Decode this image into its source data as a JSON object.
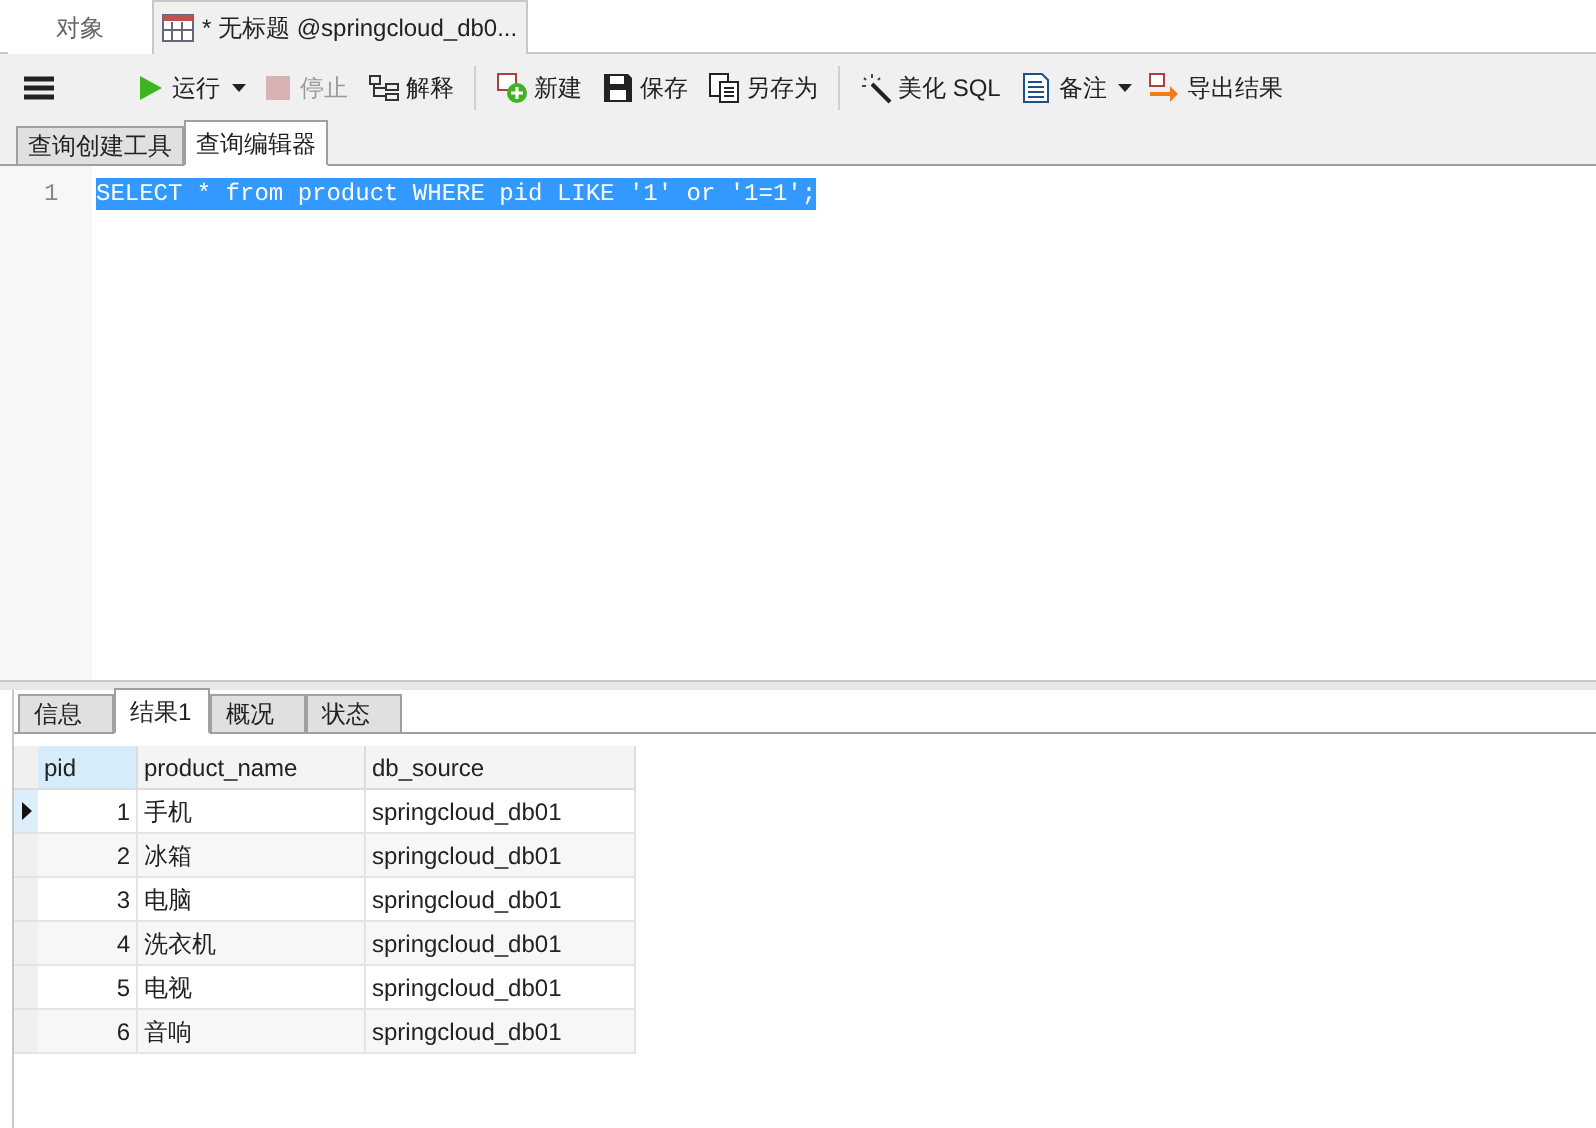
{
  "doc_tabs": [
    {
      "label": "对象",
      "selected": false
    },
    {
      "label": "* 无标题 @springcloud_db0...",
      "selected": true
    }
  ],
  "toolbar": {
    "groups": [
      [
        {
          "label": "运行",
          "disabled": false,
          "has_menu": true
        },
        {
          "label": "停止",
          "disabled": true,
          "has_menu": false
        },
        {
          "label": "解释",
          "disabled": false,
          "has_menu": false
        }
      ],
      [
        {
          "label": "新建",
          "disabled": false,
          "has_menu": false
        },
        {
          "label": "保存",
          "disabled": false,
          "has_menu": false
        },
        {
          "label": "另存为",
          "disabled": false,
          "has_menu": false
        }
      ],
      [
        {
          "label": "美化 SQL",
          "disabled": false,
          "has_menu": false
        },
        {
          "label": "备注",
          "disabled": false,
          "has_menu": true
        },
        {
          "label": "导出结果",
          "disabled": false,
          "has_menu": false
        }
      ]
    ]
  },
  "editor_tabs": [
    {
      "label": "查询创建工具",
      "selected": false
    },
    {
      "label": "查询编辑器",
      "selected": true
    }
  ],
  "editor": {
    "lines": [
      {
        "number": "1",
        "text": "SELECT * from product WHERE pid LIKE '1' or '1=1';",
        "selected": true
      }
    ]
  },
  "result_tabs": [
    {
      "label": "信息",
      "selected": false
    },
    {
      "label": "结果1",
      "selected": true
    },
    {
      "label": "概况",
      "selected": false
    },
    {
      "label": "状态",
      "selected": false
    }
  ],
  "table": {
    "columns": [
      "pid",
      "product_name",
      "db_source"
    ],
    "rows": [
      {
        "cells": [
          "1",
          "手机",
          "springcloud_db01"
        ],
        "selected": true
      },
      {
        "cells": [
          "2",
          "冰箱",
          "springcloud_db01"
        ],
        "selected": false
      },
      {
        "cells": [
          "3",
          "电脑",
          "springcloud_db01"
        ],
        "selected": false
      },
      {
        "cells": [
          "4",
          "洗衣机",
          "springcloud_db01"
        ],
        "selected": false
      },
      {
        "cells": [
          "5",
          "电视",
          "springcloud_db01"
        ],
        "selected": false
      },
      {
        "cells": [
          "6",
          "音响",
          "springcloud_db01"
        ],
        "selected": false
      }
    ]
  }
}
